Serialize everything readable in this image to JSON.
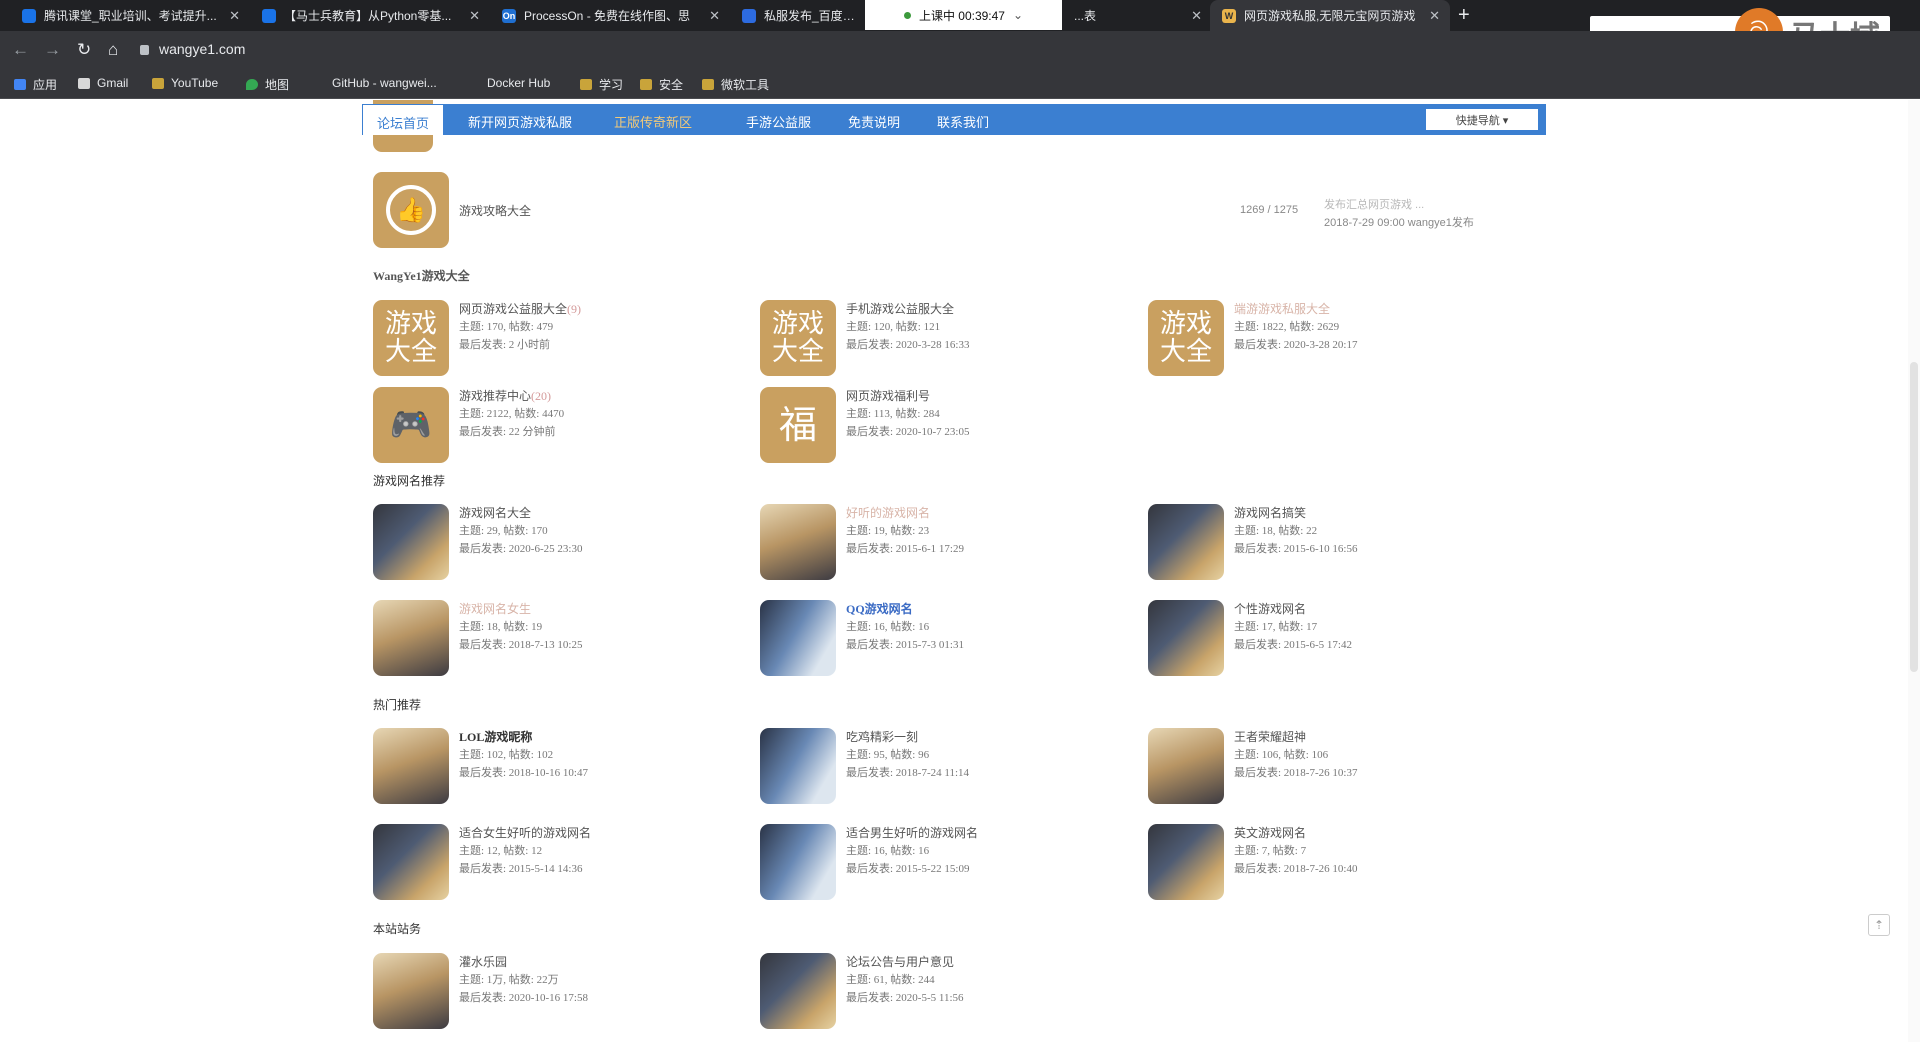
{
  "browser": {
    "tabs": [
      {
        "label": "腾讯课堂_职业培训、考试提升...",
        "fav": "blue"
      },
      {
        "label": "【马士兵教育】从Python零基...",
        "fav": "blue"
      },
      {
        "label": "ProcessOn - 免费在线作图、思",
        "fav": "On"
      },
      {
        "label": "私服发布_百度搜索",
        "fav": "paw"
      },
      {
        "label": "...表",
        "fav": ""
      },
      {
        "label": "网页游戏私服,无限元宝网页游戏",
        "fav": "W"
      }
    ],
    "recording": "上课中 00:39:47",
    "url": "wangye1.com",
    "bookmarks": [
      "应用",
      "Gmail",
      "YouTube",
      "地图",
      "GitHub - wangwei...",
      "Docker Hub",
      "学习",
      "安全",
      "微软工具"
    ],
    "annot_brand": "马士域"
  },
  "nav": {
    "items": [
      "论坛首页",
      "新开网页游戏私服",
      "正版传奇新区",
      "手游公益服",
      "免责说明",
      "联系我们"
    ],
    "quick": "快捷导航 ▾"
  },
  "single_forum": {
    "name": "游戏攻略大全",
    "stats": "1269 / 1275",
    "last_title": "发布汇总网页游戏 ...",
    "last_time": "2018-7-29 09:00 wangye1发布"
  },
  "sections": [
    {
      "title": "WangYe1游戏大全",
      "forums": [
        {
          "name": "网页游戏公益服大全",
          "count": "(9)",
          "m1": "主题: 170, 帖数: 479",
          "m2": "最后发表: 2 小时前",
          "icon": "游戏大全"
        },
        {
          "name": "手机游戏公益服大全",
          "count": "",
          "m1": "主题: 120, 帖数: 121",
          "m2": "最后发表: 2020-3-28 16:33",
          "icon": "游戏大全"
        },
        {
          "name": "端游游戏私服大全",
          "count": "",
          "m1": "主题: 1822, 帖数: 2629",
          "m2": "最后发表: 2020-3-28 20:17",
          "icon": "游戏大全"
        },
        {
          "name": "游戏推荐中心",
          "count": "(20)",
          "m1": "主题: 2122, 帖数: 4470",
          "m2": "最后发表: 22 分钟前",
          "icon": "🎮"
        },
        {
          "name": "网页游戏福利号",
          "count": "",
          "m1": "主题: 113, 帖数: 284",
          "m2": "最后发表: 2020-10-7 23:05",
          "icon": "福"
        }
      ]
    },
    {
      "title": "游戏网名推荐",
      "forums": [
        {
          "name": "游戏网名大全",
          "m1": "主题: 29, 帖数: 170",
          "m2": "最后发表: 2020-6-25 23:30"
        },
        {
          "name": "好听的游戏网名",
          "m1": "主题: 19, 帖数: 23",
          "m2": "最后发表: 2015-6-1 17:29"
        },
        {
          "name": "游戏网名搞笑",
          "m1": "主题: 18, 帖数: 22",
          "m2": "最后发表: 2015-6-10 16:56"
        },
        {
          "name": "游戏网名女生",
          "m1": "主题: 18, 帖数: 19",
          "m2": "最后发表: 2018-7-13 10:25"
        },
        {
          "name": "QQ游戏网名",
          "m1": "主题: 16, 帖数: 16",
          "m2": "最后发表: 2015-7-3 01:31"
        },
        {
          "name": "个性游戏网名",
          "m1": "主题: 17, 帖数: 17",
          "m2": "最后发表: 2015-6-5 17:42"
        }
      ]
    },
    {
      "title": "热门推荐",
      "forums": [
        {
          "name": "LOL游戏昵称",
          "m1": "主题: 102, 帖数: 102",
          "m2": "最后发表: 2018-10-16 10:47"
        },
        {
          "name": "吃鸡精彩一刻",
          "m1": "主题: 95, 帖数: 96",
          "m2": "最后发表: 2018-7-24 11:14"
        },
        {
          "name": "王者荣耀超神",
          "m1": "主题: 106, 帖数: 106",
          "m2": "最后发表: 2018-7-26 10:37"
        },
        {
          "name": "适合女生好听的游戏网名",
          "m1": "主题: 12, 帖数: 12",
          "m2": "最后发表: 2015-5-14 14:36"
        },
        {
          "name": "适合男生好听的游戏网名",
          "m1": "主题: 16, 帖数: 16",
          "m2": "最后发表: 2015-5-22 15:09"
        },
        {
          "name": "英文游戏网名",
          "m1": "主题: 7, 帖数: 7",
          "m2": "最后发表: 2018-7-26 10:40"
        }
      ]
    },
    {
      "title": "本站站务",
      "forums": [
        {
          "name": "灌水乐园",
          "m1": "主题: 1万, 帖数: 22万",
          "m2": "最后发表: 2020-10-16 17:58"
        },
        {
          "name": "论坛公告与用户意见",
          "m1": "主题: 61, 帖数: 244",
          "m2": "最后发表: 2020-5-5 11:56"
        }
      ]
    }
  ]
}
